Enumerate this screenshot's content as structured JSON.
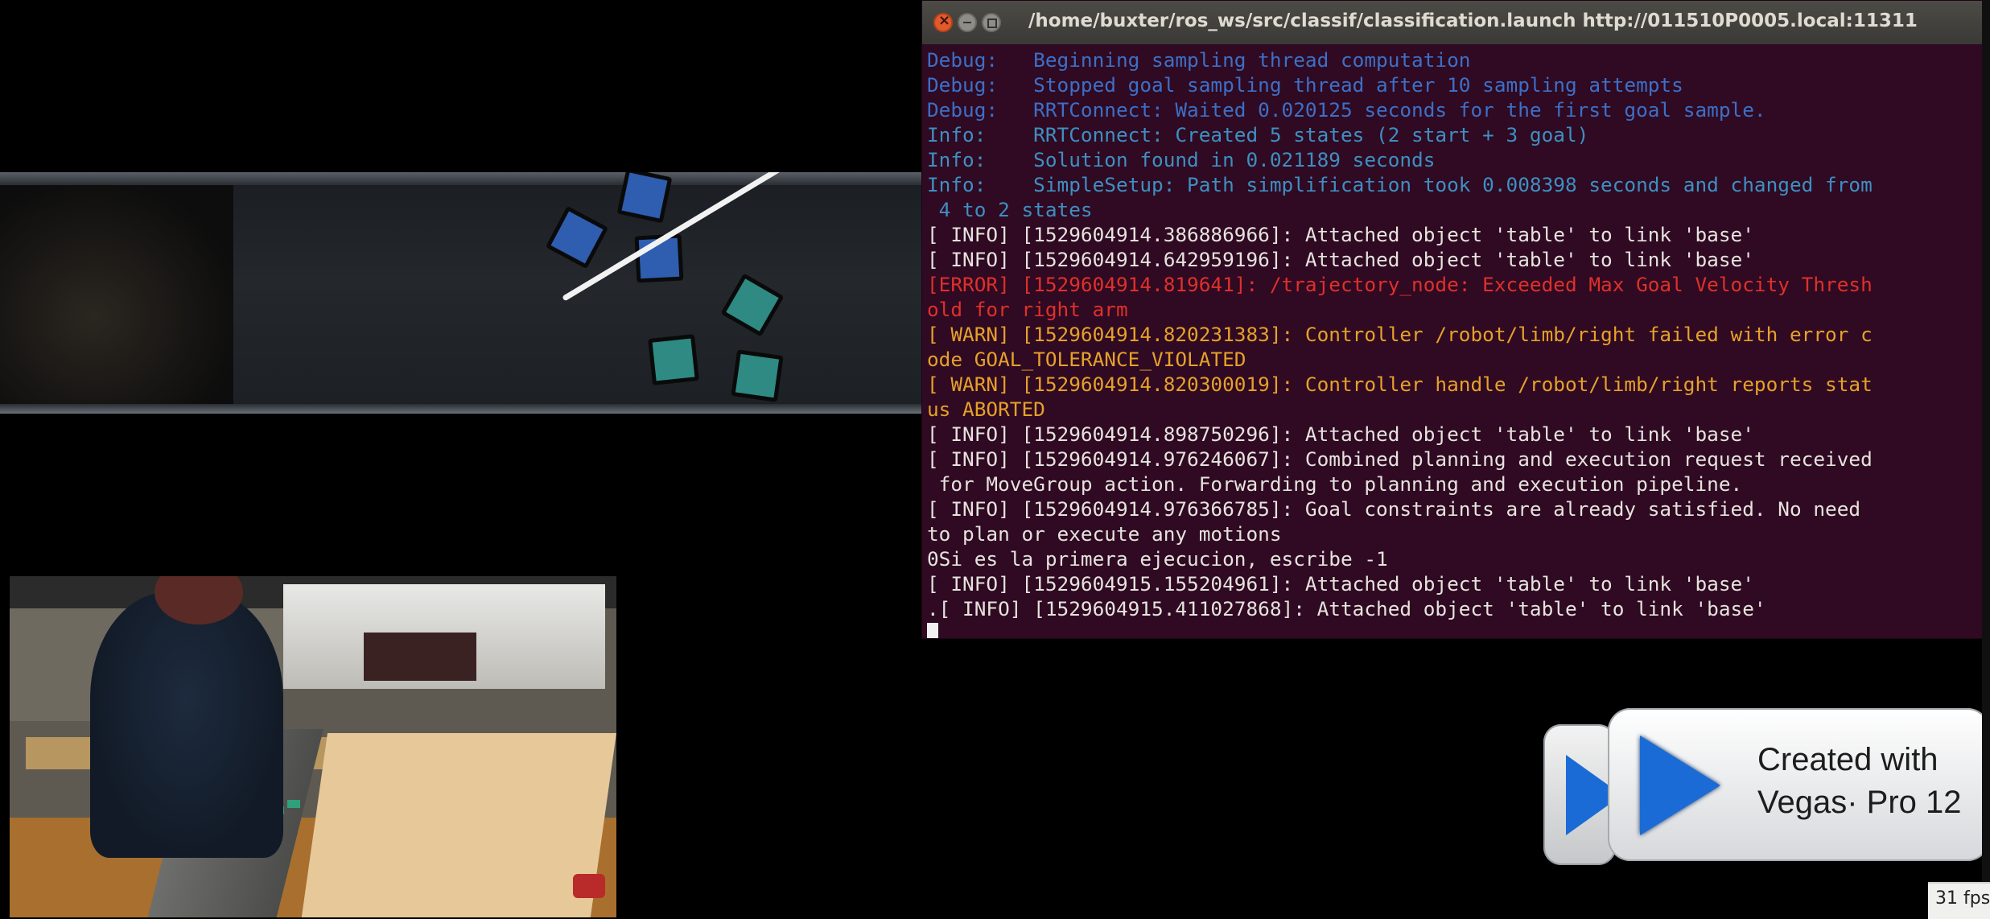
{
  "terminal": {
    "title": "/home/buxter/ros_ws/src/classif/classification.launch http://011510P0005.local:11311",
    "lines": [
      {
        "text": "Debug:   Beginning sampling thread computation",
        "level": "debug"
      },
      {
        "text": "Debug:   Stopped goal sampling thread after 10 sampling attempts",
        "level": "debug"
      },
      {
        "text": "Debug:   RRTConnect: Waited 0.020125 seconds for the first goal sample.",
        "level": "debug"
      },
      {
        "text": "Info:    RRTConnect: Created 5 states (2 start + 3 goal)",
        "level": "info"
      },
      {
        "text": "Info:    Solution found in 0.021189 seconds",
        "level": "info"
      },
      {
        "text": "Info:    SimpleSetup: Path simplification took 0.008398 seconds and changed from",
        "level": "info"
      },
      {
        "text": " 4 to 2 states",
        "level": "info"
      },
      {
        "text": "[ INFO] [1529604914.386886966]: Attached object 'table' to link 'base'",
        "level": "ok"
      },
      {
        "text": "[ INFO] [1529604914.642959196]: Attached object 'table' to link 'base'",
        "level": "ok"
      },
      {
        "text": "[ERROR] [1529604914.819641]: /trajectory_node: Exceeded Max Goal Velocity Thresh",
        "level": "error"
      },
      {
        "text": "old for right arm",
        "level": "error"
      },
      {
        "text": "[ WARN] [1529604914.820231383]: Controller /robot/limb/right failed with error c",
        "level": "warn"
      },
      {
        "text": "ode GOAL_TOLERANCE_VIOLATED",
        "level": "warn"
      },
      {
        "text": "[ WARN] [1529604914.820300019]: Controller handle /robot/limb/right reports stat",
        "level": "warn"
      },
      {
        "text": "us ABORTED",
        "level": "warn"
      },
      {
        "text": "[ INFO] [1529604914.898750296]: Attached object 'table' to link 'base'",
        "level": "ok"
      },
      {
        "text": "[ INFO] [1529604914.976246067]: Combined planning and execution request received",
        "level": "ok"
      },
      {
        "text": " for MoveGroup action. Forwarding to planning and execution pipeline.",
        "level": "ok"
      },
      {
        "text": "[ INFO] [1529604914.976366785]: Goal constraints are already satisfied. No need",
        "level": "ok"
      },
      {
        "text": "to plan or execute any motions",
        "level": "ok"
      },
      {
        "text": "0Si es la primera ejecucion, escribe -1",
        "level": "ok"
      },
      {
        "text": "[ INFO] [1529604915.155204961]: Attached object 'table' to link 'base'",
        "level": "ok"
      },
      {
        "text": ".[ INFO] [1529604915.411027868]: Attached object 'table' to link 'base'",
        "level": "ok"
      }
    ]
  },
  "watermark": {
    "line1": "Created with",
    "line2": "Vegas· Pro 12"
  },
  "fps": "31 fps",
  "colors": {
    "terminal_bg": "#2f0a22",
    "debug": "#3d6fc7",
    "info": "#3e8fc2",
    "error": "#e0302a",
    "warn": "#e6a12a",
    "cube_blue": "#2f5db0",
    "cube_teal": "#2e8a82"
  }
}
